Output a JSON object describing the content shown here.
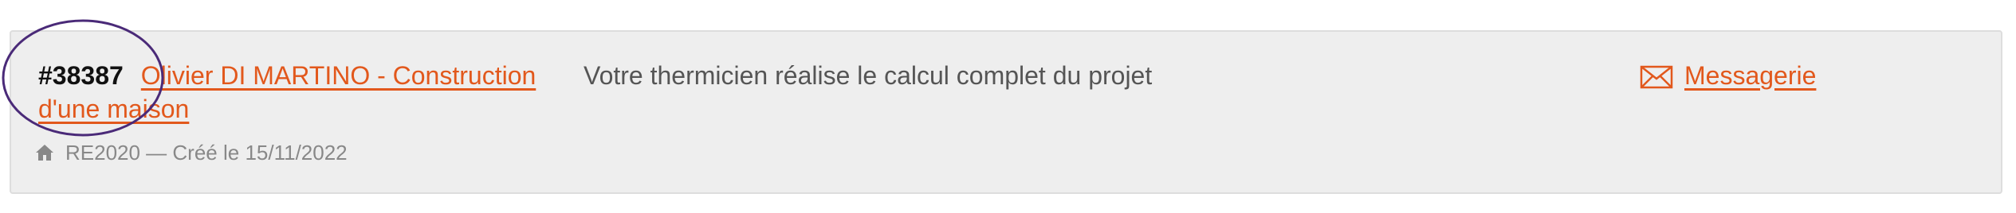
{
  "project": {
    "id": "#38387",
    "title": "Olivier DI MARTINO - Construction d'une maison",
    "meta": "RE2020 — Créé le 15/11/2022",
    "status": "Votre thermicien réalise le calcul complet du projet"
  },
  "messaging": {
    "label": "Messagerie"
  },
  "icons": {
    "meta": "home-icon",
    "messaging": "mail-icon"
  },
  "colors": {
    "link": "#e2581c",
    "annotation": "#4a2a78",
    "card_background": "#eeeeee"
  }
}
